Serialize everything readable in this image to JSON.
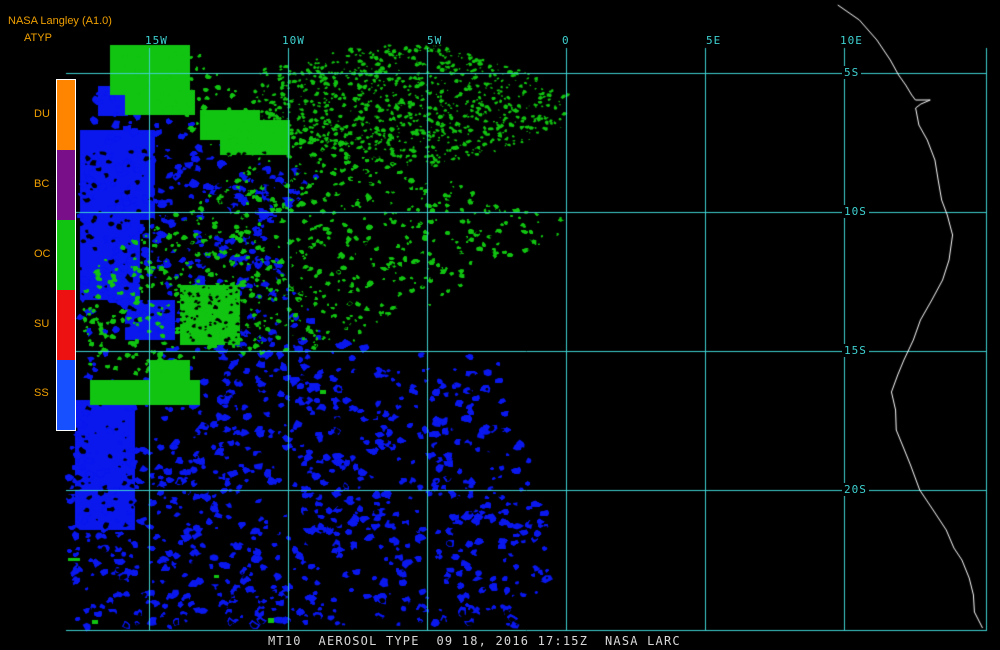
{
  "header": {
    "title": "NASA Langley (A1.0)",
    "product": "ATYP"
  },
  "legend": [
    {
      "code": "DU",
      "color": "#ff8400"
    },
    {
      "code": "BC",
      "color": "#7a0f8a"
    },
    {
      "code": "OC",
      "color": "#12c412"
    },
    {
      "code": "SU",
      "color": "#ee1111"
    },
    {
      "code": "SS",
      "color": "#1650ff"
    }
  ],
  "longitudes": [
    {
      "label": "15W",
      "value": -15
    },
    {
      "label": "10W",
      "value": -10
    },
    {
      "label": "5W",
      "value": -5
    },
    {
      "label": "0",
      "value": 0
    },
    {
      "label": "5E",
      "value": 5
    },
    {
      "label": "10E",
      "value": 10
    }
  ],
  "latitudes": [
    {
      "label": "5S",
      "value": -5
    },
    {
      "label": "10S",
      "value": -10
    },
    {
      "label": "15S",
      "value": -15
    },
    {
      "label": "20S",
      "value": -20
    }
  ],
  "colors": {
    "grid": "#3fd0d0",
    "coastline": "#ffffff",
    "organic_carbon": "#12c412",
    "sea_salt": "#0a18ee",
    "background": "#000000"
  },
  "caption": "MT10  AEROSOL TYPE  09 18, 2016 17:15Z  NASA LARC"
}
